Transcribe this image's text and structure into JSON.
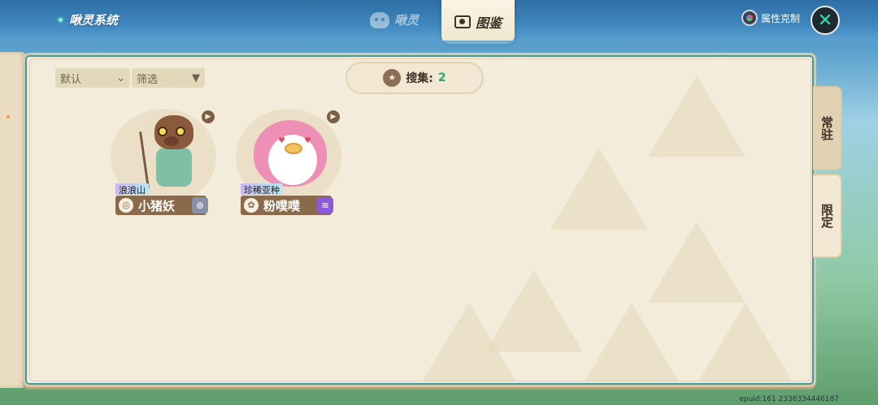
{
  "header": {
    "system_title": "啾灵系统",
    "tabs": [
      {
        "label": "啾灵",
        "icon": "spirit-icon",
        "active": false
      },
      {
        "label": "图鉴",
        "icon": "dex-icon",
        "active": true
      }
    ],
    "attr_label": "属性克制",
    "close_icon": "close-icon"
  },
  "toolbar": {
    "sort_label": "默认",
    "filter_label": "筛选"
  },
  "collection": {
    "label": "搜集:",
    "count": "2"
  },
  "cards": [
    {
      "tag": "浪浪山",
      "name": "小猪妖",
      "element_icon": "wind-element-icon",
      "badge_icon": "plus-icon",
      "badge_color": "#8a8fa8"
    },
    {
      "tag": "珍稀亚种",
      "name": "粉噗噗",
      "element_icon": "leaf-element-icon",
      "badge_icon": "wave-icon",
      "badge_color": "#8a5ad8"
    }
  ],
  "side_tabs": [
    {
      "label": "常驻",
      "active": true
    },
    {
      "label": "限定",
      "active": false
    }
  ],
  "footer": "epuid:161 2336334446187"
}
